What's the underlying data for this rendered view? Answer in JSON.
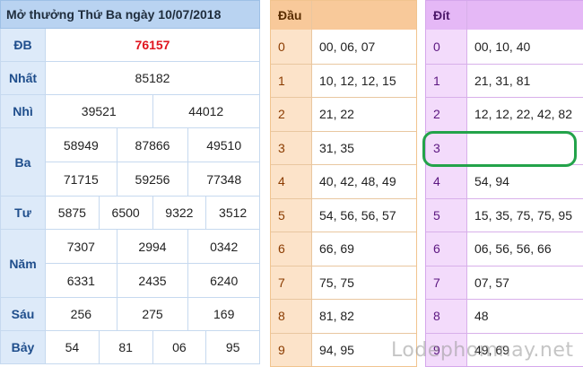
{
  "results": {
    "title": "Mở thưởng Thứ Ba ngày 10/07/2018",
    "prizes": [
      {
        "label": "ĐB",
        "lines": [
          [
            "76157"
          ]
        ]
      },
      {
        "label": "Nhất",
        "lines": [
          [
            "85182"
          ]
        ]
      },
      {
        "label": "Nhì",
        "lines": [
          [
            "39521",
            "44012"
          ]
        ]
      },
      {
        "label": "Ba",
        "lines": [
          [
            "58949",
            "87866",
            "49510"
          ],
          [
            "71715",
            "59256",
            "77348"
          ]
        ]
      },
      {
        "label": "Tư",
        "lines": [
          [
            "5875",
            "6500",
            "9322",
            "3512"
          ]
        ]
      },
      {
        "label": "Năm",
        "lines": [
          [
            "7307",
            "2994",
            "0342"
          ],
          [
            "6331",
            "2435",
            "6240"
          ]
        ]
      },
      {
        "label": "Sáu",
        "lines": [
          [
            "256",
            "275",
            "169"
          ]
        ]
      },
      {
        "label": "Bảy",
        "lines": [
          [
            "54",
            "81",
            "06",
            "95"
          ]
        ]
      }
    ]
  },
  "dau": {
    "header": "Đầu",
    "rows": [
      {
        "k": "0",
        "v": "00, 06, 07"
      },
      {
        "k": "1",
        "v": "10, 12, 12, 15"
      },
      {
        "k": "2",
        "v": "21, 22"
      },
      {
        "k": "3",
        "v": "31, 35"
      },
      {
        "k": "4",
        "v": "40, 42, 48, 49"
      },
      {
        "k": "5",
        "v": "54, 56, 56, 57"
      },
      {
        "k": "6",
        "v": "66, 69"
      },
      {
        "k": "7",
        "v": "75, 75"
      },
      {
        "k": "8",
        "v": "81, 82"
      },
      {
        "k": "9",
        "v": "94, 95"
      }
    ]
  },
  "dit": {
    "header": "Đít",
    "rows": [
      {
        "k": "0",
        "v": "00, 10, 40"
      },
      {
        "k": "1",
        "v": "21, 31, 81"
      },
      {
        "k": "2",
        "v": "12, 12, 22, 42, 82"
      },
      {
        "k": "3",
        "v": ""
      },
      {
        "k": "4",
        "v": "54, 94"
      },
      {
        "k": "5",
        "v": "15, 35, 75, 75, 95"
      },
      {
        "k": "6",
        "v": "06, 56, 56, 66"
      },
      {
        "k": "7",
        "v": "07, 57"
      },
      {
        "k": "8",
        "v": "48"
      },
      {
        "k": "9",
        "v": "49, 69"
      }
    ]
  },
  "watermark": "Lodephomnay.net",
  "colors": {
    "special_number": "#e0141e",
    "results_header": "#b9d3f1",
    "dau_header": "#f8c99a",
    "dit_header": "#e5b8f6",
    "highlight": "#23a34a"
  }
}
